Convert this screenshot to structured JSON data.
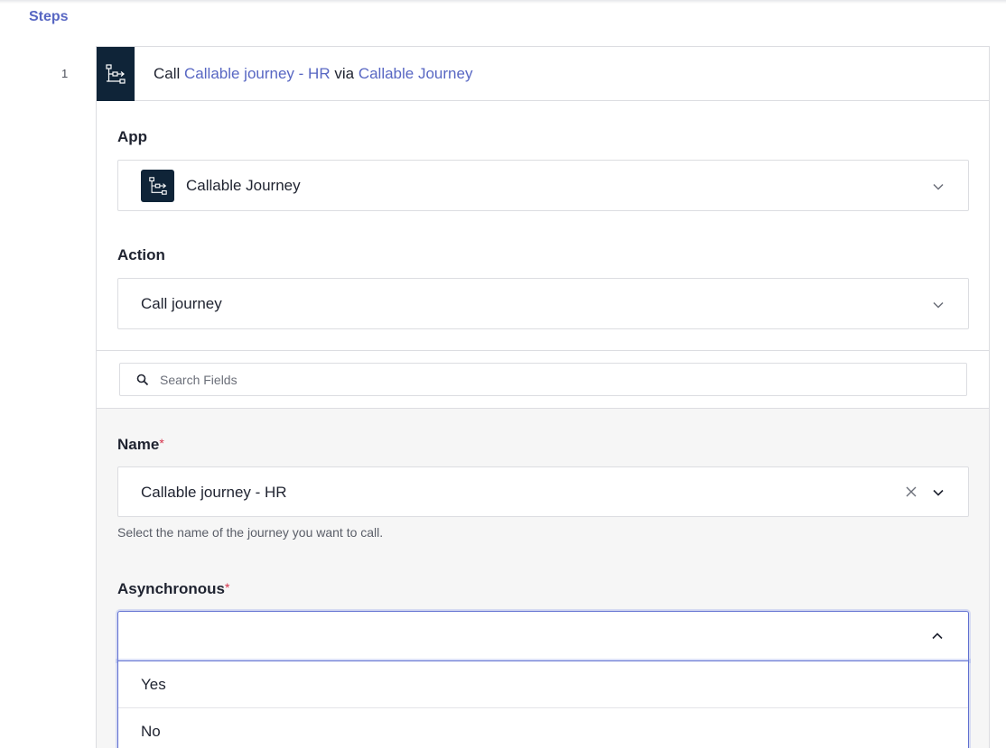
{
  "section": {
    "title": "Steps"
  },
  "step": {
    "number": "1",
    "title_prefix": "Call",
    "journey_link": "Callable journey - HR",
    "title_via": "via",
    "app_link": "Callable Journey",
    "icon": "callable-journey-icon"
  },
  "app": {
    "label": "App",
    "value": "Callable Journey",
    "icon": "callable-journey-icon"
  },
  "action": {
    "label": "Action",
    "value": "Call journey"
  },
  "search": {
    "placeholder": "Search Fields",
    "icon": "search-icon"
  },
  "name_field": {
    "label": "Name",
    "required_mark": "*",
    "value": "Callable journey - HR",
    "help": "Select the name of the journey you want to call."
  },
  "async_field": {
    "label": "Asynchronous",
    "required_mark": "*",
    "value": "",
    "options": [
      "Yes",
      "No"
    ]
  },
  "colors": {
    "accent": "#5867c3",
    "icon_tile": "#0f2438",
    "required": "#d6334b",
    "focus_border": "#5f6fd0"
  }
}
